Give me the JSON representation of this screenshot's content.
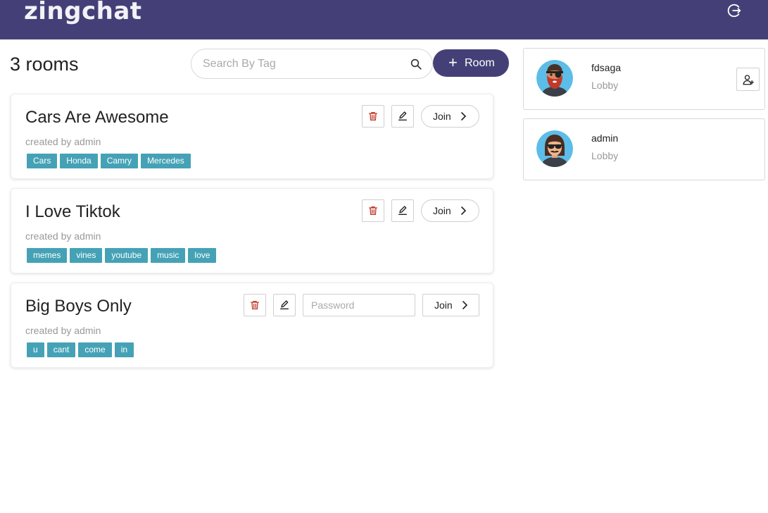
{
  "header": {
    "logo": "zingchat",
    "logout_icon": "logout-icon"
  },
  "toolbar": {
    "rooms_count": "3 rooms",
    "search_placeholder": "Search By Tag",
    "add_room_label": "Room"
  },
  "rooms": [
    {
      "title": "Cars Are Awesome",
      "created_by": "created by admin",
      "tags": [
        "Cars",
        "Honda",
        "Camry",
        "Mercedes"
      ],
      "join_label": "Join",
      "locked": false
    },
    {
      "title": "I Love Tiktok",
      "created_by": "created by admin",
      "tags": [
        "memes",
        "vines",
        "youtube",
        "music",
        "love"
      ],
      "join_label": "Join",
      "locked": false
    },
    {
      "title": "Big Boys Only",
      "created_by": "created by admin",
      "tags": [
        "u",
        "cant",
        "come",
        "in"
      ],
      "join_label": "Join",
      "locked": true,
      "password_placeholder": "Password"
    }
  ],
  "users": [
    {
      "name": "fdsaga",
      "status": "Lobby",
      "can_add": true
    },
    {
      "name": "admin",
      "status": "Lobby",
      "can_add": false
    }
  ],
  "colors": {
    "brand": "#444077",
    "tag": "#45a2b6",
    "delete": "#c0392b"
  }
}
